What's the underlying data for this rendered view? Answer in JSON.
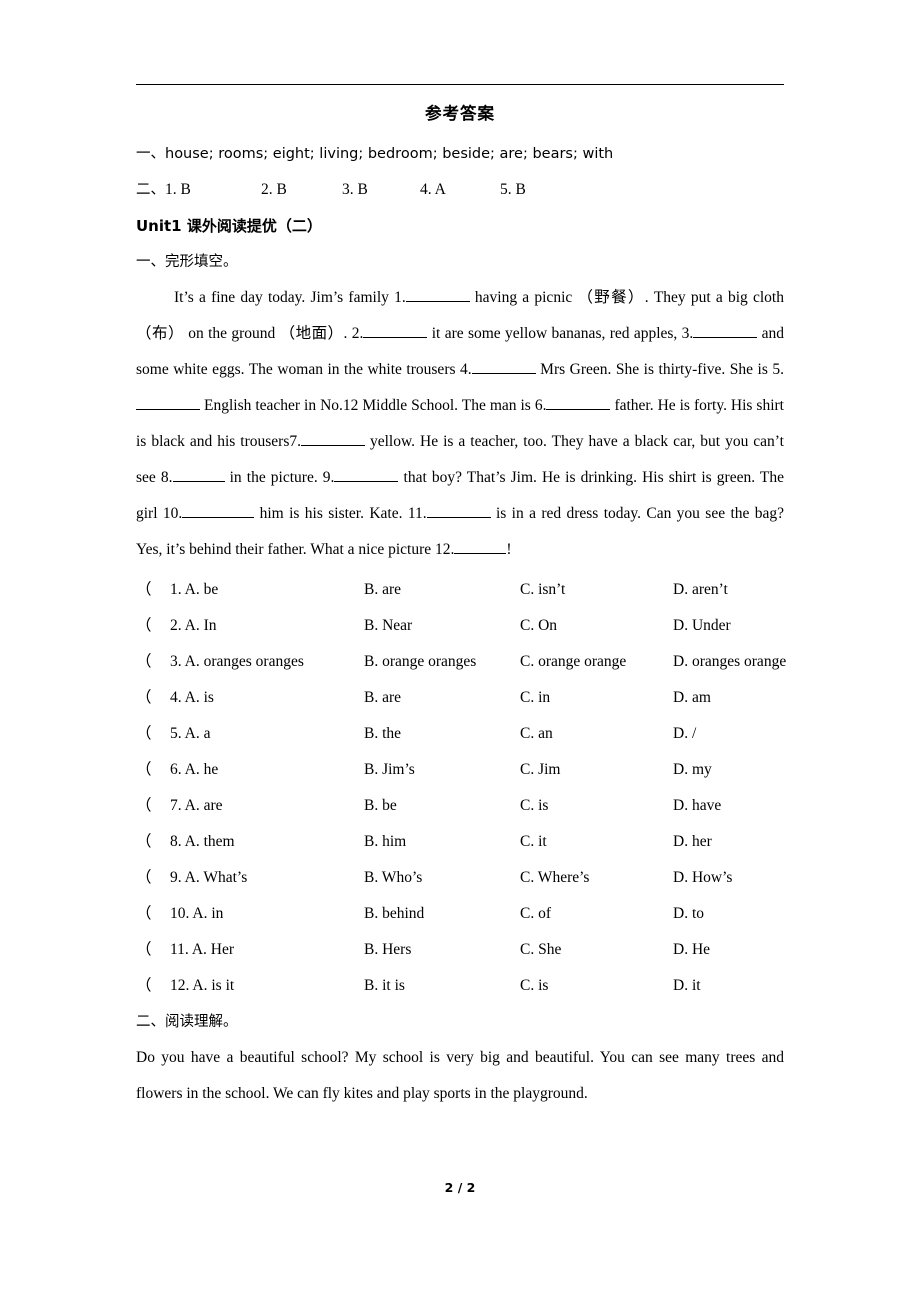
{
  "document": {
    "title": "参考答案",
    "page_number": "2 / 2",
    "answers": {
      "line1": "一、house; rooms; eight; living; bedroom; beside; are; bears; with",
      "line2_prefix": "二、",
      "line2_items": [
        "1. B",
        "2. B",
        "3. B",
        "4. A",
        "5. B"
      ]
    },
    "unit_heading": "Unit1 课外阅读提优（二）",
    "section1_heading": "一、完形填空。",
    "cloze": {
      "seg1": "It’s a fine day today. Jim’s family 1.",
      "seg2": "having a picnic （野餐）. They put a big cloth （布） on the ground （地面）. 2.",
      "seg3": "it are some yellow bananas, red apples, 3.",
      "seg4": "and some white eggs. The woman in the white trousers 4.",
      "seg5": "Mrs Green. She is thirty-five. She is 5.",
      "seg6": "English teacher in No.12 Middle School. The man is 6.",
      "seg7": "father. He is forty. His shirt is black and his trousers7.",
      "seg8": "yellow. He is a teacher, too. They have a black car, but you can’t see 8.",
      "seg9": "in the picture. 9.",
      "seg10": "that boy? That’s Jim. He is drinking. His shirt is green. The girl 10.",
      "seg11": "him is his sister. Kate. 11.",
      "seg12": "is in a red dress today. Can you see the bag? Yes, it’s behind their father. What a nice picture 12.",
      "seg13": "!"
    },
    "choices": [
      {
        "paren": "（",
        "num": "1.",
        "a": "A. be",
        "b": "B. are",
        "c": "C. isn’t",
        "d": "D. aren’t"
      },
      {
        "paren": "（",
        "num": "2.",
        "a": "A. In",
        "b": "B. Near",
        "c": "C. On",
        "d": "D. Under"
      },
      {
        "paren": "（",
        "num": "3.",
        "a": "A. oranges oranges",
        "b": "B. orange oranges",
        "c": "C. orange orange",
        "d": "D. oranges orange"
      },
      {
        "paren": "（",
        "num": "4.",
        "a": "A. is",
        "b": "B. are",
        "c": "C. in",
        "d": "D. am"
      },
      {
        "paren": "（",
        "num": "5.",
        "a": "A. a",
        "b": "B. the",
        "c": "C. an",
        "d": "D. /"
      },
      {
        "paren": "（",
        "num": "6.",
        "a": "A. he",
        "b": "B. Jim’s",
        "c": "C. Jim",
        "d": "D. my"
      },
      {
        "paren": "（",
        "num": "7.",
        "a": "A. are",
        "b": "B. be",
        "c": "C. is",
        "d": "D. have"
      },
      {
        "paren": "（",
        "num": "8.",
        "a": "A. them",
        "b": "B. him",
        "c": "C. it",
        "d": "D. her"
      },
      {
        "paren": "（",
        "num": "9.",
        "a": "A. What’s",
        "b": "B. Who’s",
        "c": "C. Where’s",
        "d": "D. How’s"
      },
      {
        "paren": "（",
        "num": "10.",
        "a": "A. in",
        "b": "B. behind",
        "c": "C. of",
        "d": "D. to"
      },
      {
        "paren": "（",
        "num": "11.",
        "a": "A. Her",
        "b": "B. Hers",
        "c": "C. She",
        "d": "D. He"
      },
      {
        "paren": "（",
        "num": "12.",
        "a": "A. is it",
        "b": "B. it is",
        "c": "C. is",
        "d": "D. it"
      }
    ],
    "section2_heading": "二、阅读理解。",
    "reading_passage": "Do you have a beautiful school? My school is very big and beautiful. You can see many trees and flowers in the school. We can fly kites and play sports in the playground."
  }
}
